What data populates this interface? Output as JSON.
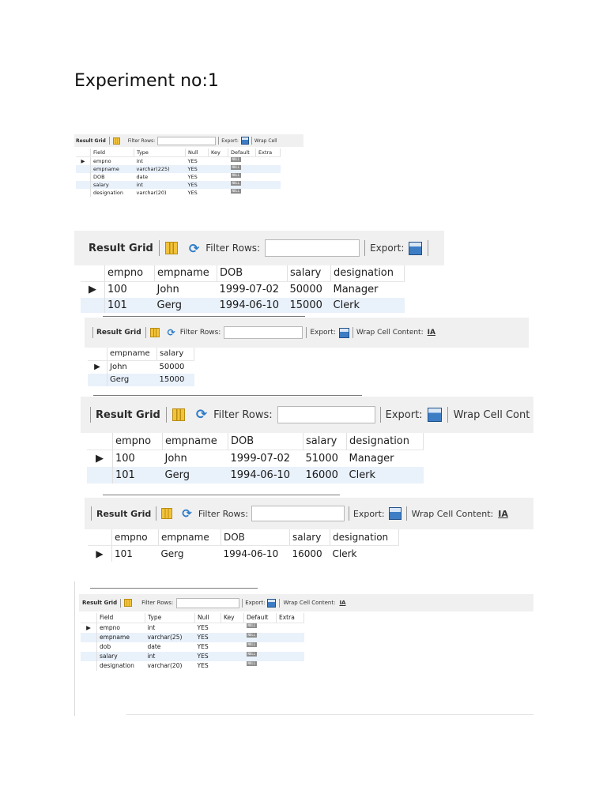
{
  "page": {
    "title": "Experiment no:1"
  },
  "toolbar": {
    "result_grid": "Result Grid",
    "filter_rows": "Filter Rows:",
    "export": "Export:",
    "wrap_cell_content": "Wrap Cell Content:",
    "wrap_cell_truncated_1": "Wrap Cell",
    "wrap_cell_truncated_4": "Wrap Cell Cont",
    "wrap_cell_truncated_5": "Wrap Cell Content:"
  },
  "describe1": {
    "headers": [
      "Field",
      "Type",
      "Null",
      "Key",
      "Default",
      "Extra"
    ],
    "rows": [
      [
        "empno",
        "int",
        "YES",
        "",
        "NULL",
        ""
      ],
      [
        "empname",
        "varchar(225)",
        "YES",
        "",
        "NULL",
        ""
      ],
      [
        "DOB",
        "date",
        "YES",
        "",
        "NULL",
        ""
      ],
      [
        "salary",
        "int",
        "YES",
        "",
        "NULL",
        ""
      ],
      [
        "designation",
        "varchar(20)",
        "YES",
        "",
        "NULL",
        ""
      ]
    ]
  },
  "select_all": {
    "headers": [
      "empno",
      "empname",
      "DOB",
      "salary",
      "designation"
    ],
    "rows": [
      [
        "100",
        "John",
        "1999-07-02",
        "50000",
        "Manager"
      ],
      [
        "101",
        "Gerg",
        "1994-06-10",
        "15000",
        "Clerk"
      ]
    ]
  },
  "select_name_salary": {
    "headers": [
      "empname",
      "salary"
    ],
    "rows": [
      [
        "John",
        "50000"
      ],
      [
        "Gerg",
        "15000"
      ]
    ]
  },
  "select_updated": {
    "headers": [
      "empno",
      "empname",
      "DOB",
      "salary",
      "designation"
    ],
    "rows": [
      [
        "100",
        "John",
        "1999-07-02",
        "51000",
        "Manager"
      ],
      [
        "101",
        "Gerg",
        "1994-06-10",
        "16000",
        "Clerk"
      ]
    ]
  },
  "select_after_delete": {
    "headers": [
      "empno",
      "empname",
      "DOB",
      "salary",
      "designation"
    ],
    "rows": [
      [
        "101",
        "Gerg",
        "1994-06-10",
        "16000",
        "Clerk"
      ]
    ]
  },
  "describe2": {
    "headers": [
      "Field",
      "Type",
      "Null",
      "Key",
      "Default",
      "Extra"
    ],
    "rows": [
      [
        "empno",
        "int",
        "YES",
        "",
        "NULL",
        ""
      ],
      [
        "empname",
        "varchar(25)",
        "YES",
        "",
        "NULL",
        ""
      ],
      [
        "dob",
        "date",
        "YES",
        "",
        "NULL",
        ""
      ],
      [
        "salary",
        "int",
        "YES",
        "",
        "NULL",
        ""
      ],
      [
        "designation",
        "varchar(20)",
        "YES",
        "",
        "NULL",
        ""
      ]
    ]
  },
  "colors": {
    "toolbar_bg": "#f0f0f0",
    "alt_row": "#e9f1fb",
    "grid_icon": "#f2c23a",
    "refresh_icon": "#2c7bc8",
    "export_icon": "#3d7dc4",
    "null_badge": "#8d8d8d"
  },
  "icons": {
    "row_pointer": "▶",
    "refresh": "⟳",
    "wrap": "IA"
  }
}
